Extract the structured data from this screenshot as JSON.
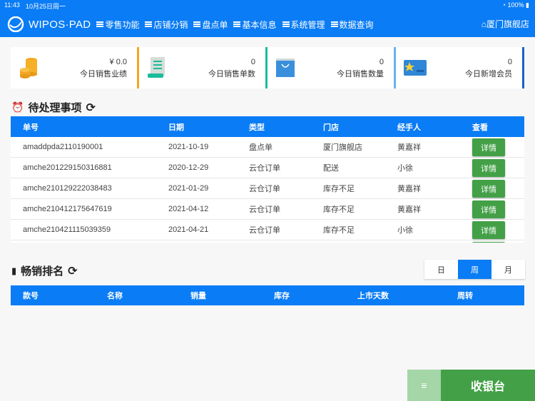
{
  "status": {
    "time": "11:43",
    "date": "10月25日周一",
    "battery": "100%"
  },
  "nav": {
    "brand": "WIPOS·PAD",
    "menus": [
      "零售功能",
      "店铺分销",
      "盘点单",
      "基本信息",
      "系统管理",
      "数据查询"
    ],
    "store": "厦门旗舰店"
  },
  "cards": [
    {
      "value": "¥ 0.0",
      "label": "今日销售业绩",
      "icon": "coins-icon",
      "color": "#f5a623"
    },
    {
      "value": "0",
      "label": "今日销售单数",
      "icon": "receipt-icon",
      "color": "#1abc9c"
    },
    {
      "value": "0",
      "label": "今日销售数量",
      "icon": "shopping-bag-icon",
      "color": "#64b5f6"
    },
    {
      "value": "0",
      "label": "今日新增会员",
      "icon": "member-card-icon",
      "color": "#1565c0"
    }
  ],
  "pending": {
    "title": "待处理事项",
    "headers": [
      "单号",
      "日期",
      "类型",
      "门店",
      "经手人",
      "查看"
    ],
    "rows": [
      [
        "amaddpda2110190001",
        "2021-10-19",
        "盘点单",
        "厦门旗舰店",
        "黄嘉祥",
        "详情"
      ],
      [
        "amche201229150316881",
        "2020-12-29",
        "云仓订单",
        "配送",
        "小徐",
        "详情"
      ],
      [
        "amche210129222038483",
        "2021-01-29",
        "云仓订单",
        "库存不足",
        "黄嘉祥",
        "详情"
      ],
      [
        "amche210412175647619",
        "2021-04-12",
        "云仓订单",
        "库存不足",
        "黄嘉祥",
        "详情"
      ],
      [
        "amche210421115039359",
        "2021-04-21",
        "云仓订单",
        "库存不足",
        "小徐",
        "详情"
      ]
    ]
  },
  "ranking": {
    "title": "畅销排名",
    "periods": [
      "日",
      "周",
      "月"
    ],
    "selected": "周",
    "headers": [
      "款号",
      "名称",
      "销量",
      "库存",
      "上市天数",
      "周转"
    ]
  },
  "cashier": {
    "label": "收银台"
  }
}
